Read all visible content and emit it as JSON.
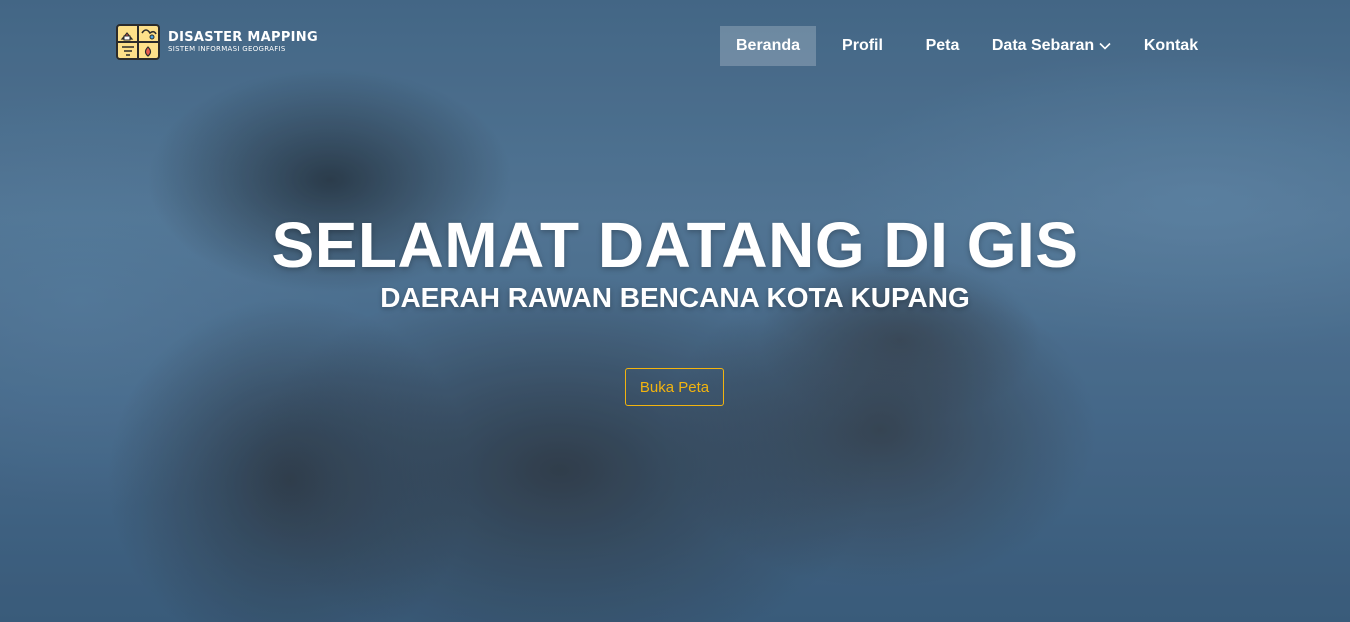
{
  "header": {
    "logo_title": "DISASTER MAPPING",
    "logo_subtitle": "SISTEM INFORMASI GEOGRAFIS"
  },
  "nav": {
    "items": [
      {
        "label": "Beranda",
        "active": true
      },
      {
        "label": "Profil"
      },
      {
        "label": "Peta"
      },
      {
        "label": "Data Sebaran",
        "has_dropdown": true
      },
      {
        "label": "Kontak"
      }
    ]
  },
  "hero": {
    "title": "SELAMAT DATANG DI GIS",
    "subtitle": "DAERAH RAWAN BENCANA KOTA KUPANG",
    "cta_label": "Buka Peta"
  },
  "colors": {
    "accent": "#f2b40f",
    "text": "#ffffff",
    "logo_bg": "#fde08a",
    "logo_stroke": "#2b2b2b"
  },
  "icons": {
    "logo": "disaster-mapping-logo-icon",
    "dropdown": "chevron-down-icon"
  }
}
